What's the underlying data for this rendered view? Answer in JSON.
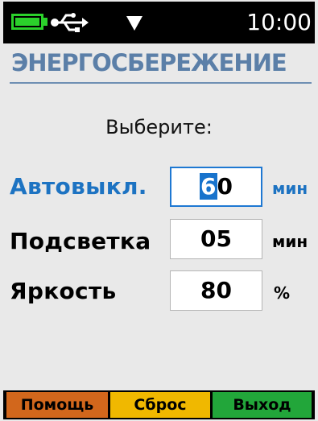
{
  "status": {
    "time": "10:00",
    "icons": [
      "battery-icon",
      "usb-icon",
      "signal-icon"
    ],
    "battery_color": "#2bd12b"
  },
  "title": "ЭНЕРГОСБЕРЕЖЕНИЕ",
  "prompt": "Выберите:",
  "rows": [
    {
      "label": "Автовыкл.",
      "value_cursor": "6",
      "value_rest": "0",
      "unit": "мин",
      "active": true
    },
    {
      "label": "Подсветка",
      "value": "05",
      "unit": "мин",
      "active": false
    },
    {
      "label": "Яркость",
      "value": "80",
      "unit": "%",
      "active": false
    }
  ],
  "softkeys": {
    "help": "Помощь",
    "reset": "Сброс",
    "exit": "Выход"
  },
  "colors": {
    "accent": "#1d73c2",
    "title": "#5b7fa8",
    "help": "#d2671c",
    "reset": "#f0b800",
    "exit": "#22a63a"
  }
}
